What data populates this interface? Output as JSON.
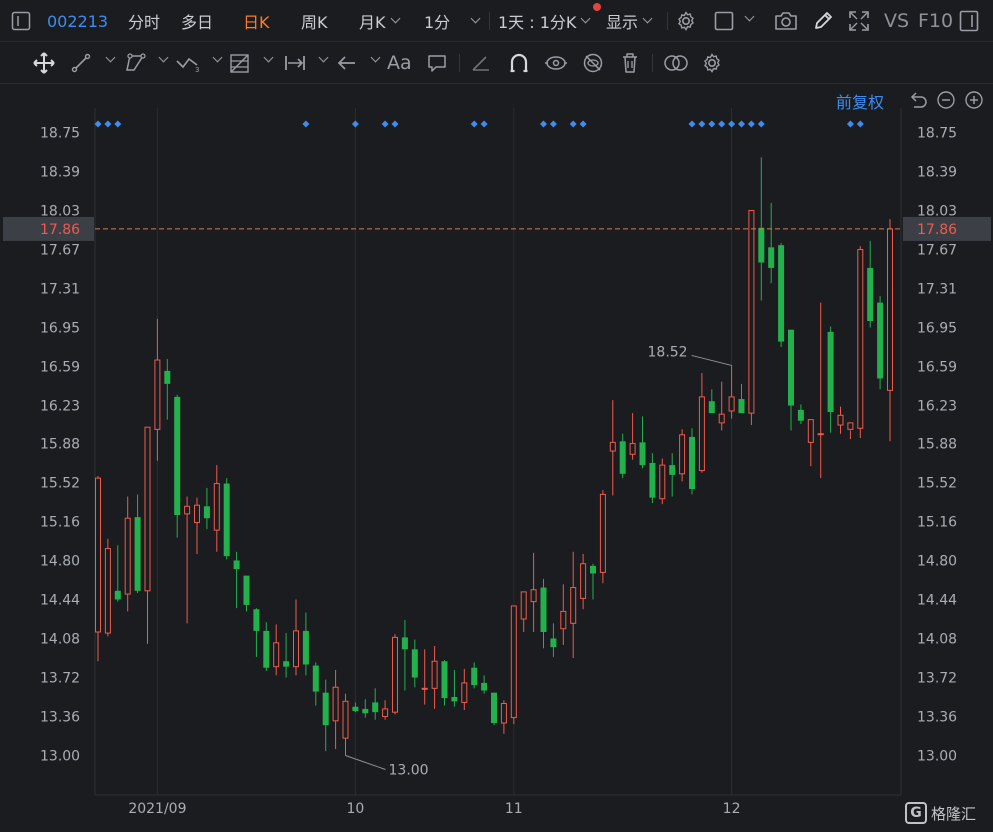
{
  "topbar": {
    "stock_code": "002213",
    "tabs": [
      {
        "label": "分时",
        "active": false
      },
      {
        "label": "多日",
        "active": false
      },
      {
        "label": "日K",
        "active": true
      },
      {
        "label": "周K",
        "active": false
      },
      {
        "label": "月K",
        "active": false
      }
    ],
    "interval": "1分",
    "range": "1天 : 1分K",
    "display": "显示",
    "vs_label": "VS",
    "f10_label": "F10",
    "icons": [
      "sidebar-toggle-icon",
      "settings-gear-icon",
      "square-layout-icon",
      "camera-icon",
      "pencil-icon",
      "expand-icon",
      "window-icon"
    ]
  },
  "toolbar": {
    "icons": [
      "move-crosshair-icon",
      "line-tool-icon",
      "polyline-tool-icon",
      "wave-tool-icon",
      "fib-grid-icon",
      "measure-range-icon",
      "arrow-left-icon",
      "text-aa-icon",
      "comment-icon",
      "angle-icon",
      "magnet-icon",
      "visibility-icon",
      "hide-icon",
      "trash-icon",
      "overlap-icon",
      "settings-icon"
    ],
    "text_label": "Aa"
  },
  "price_adjust": "前复权",
  "colors": {
    "up": "#ef5b4b",
    "down": "#22b14c",
    "background": "#1b1c1f",
    "grid": "#2b2c30",
    "accent": "#3d8cf0",
    "last_price_line": "#e07b3d",
    "event_marker": "#3d8cf0"
  },
  "brand": {
    "mark": "G",
    "name": "格隆汇"
  },
  "chart_data": {
    "type": "candlestick",
    "y_ticks": [
      "18.75",
      "18.39",
      "18.03",
      "17.67",
      "17.31",
      "16.95",
      "16.59",
      "16.23",
      "15.88",
      "15.52",
      "15.16",
      "14.80",
      "14.44",
      "14.08",
      "13.72",
      "13.36",
      "13.00"
    ],
    "ylim": [
      13.0,
      18.75
    ],
    "x_labels": [
      {
        "label": "2021/09",
        "index": 6
      },
      {
        "label": "10",
        "index": 26
      },
      {
        "label": "11",
        "index": 42
      },
      {
        "label": "12",
        "index": 64
      }
    ],
    "last_price": "17.86",
    "high_annotation": {
      "label": "18.52",
      "index": 64
    },
    "low_annotation": {
      "label": "13.00",
      "index": 25
    },
    "event_markers": [
      0,
      1,
      2,
      21,
      26,
      29,
      30,
      38,
      39,
      45,
      46,
      48,
      49,
      60,
      61,
      62,
      63,
      64,
      65,
      66,
      67,
      76,
      77
    ],
    "candles": [
      {
        "o": 14.14,
        "h": 15.58,
        "l": 13.87,
        "c": 15.56
      },
      {
        "o": 14.13,
        "h": 15.0,
        "l": 14.1,
        "c": 14.91
      },
      {
        "o": 14.52,
        "h": 14.94,
        "l": 14.42,
        "c": 14.44
      },
      {
        "o": 14.49,
        "h": 15.39,
        "l": 14.33,
        "c": 15.19
      },
      {
        "o": 15.2,
        "h": 15.41,
        "l": 14.5,
        "c": 14.52
      },
      {
        "o": 14.52,
        "h": 15.02,
        "l": 14.03,
        "c": 16.03
      },
      {
        "o": 16.01,
        "h": 17.03,
        "l": 15.72,
        "c": 16.65
      },
      {
        "o": 16.55,
        "h": 16.66,
        "l": 16.1,
        "c": 16.43
      },
      {
        "o": 16.31,
        "h": 16.33,
        "l": 15.01,
        "c": 15.22
      },
      {
        "o": 15.23,
        "h": 15.39,
        "l": 14.22,
        "c": 15.3
      },
      {
        "o": 15.15,
        "h": 15.38,
        "l": 14.86,
        "c": 15.31
      },
      {
        "o": 15.3,
        "h": 15.47,
        "l": 15.09,
        "c": 15.19
      },
      {
        "o": 15.08,
        "h": 15.68,
        "l": 14.88,
        "c": 15.51
      },
      {
        "o": 15.51,
        "h": 15.56,
        "l": 14.81,
        "c": 14.84
      },
      {
        "o": 14.8,
        "h": 14.88,
        "l": 14.36,
        "c": 14.72
      },
      {
        "o": 14.66,
        "h": 14.66,
        "l": 14.33,
        "c": 14.39
      },
      {
        "o": 14.35,
        "h": 14.36,
        "l": 13.91,
        "c": 14.15
      },
      {
        "o": 14.15,
        "h": 14.23,
        "l": 13.78,
        "c": 13.81
      },
      {
        "o": 13.82,
        "h": 14.21,
        "l": 13.74,
        "c": 14.04
      },
      {
        "o": 13.87,
        "h": 14.13,
        "l": 13.72,
        "c": 13.82
      },
      {
        "o": 13.82,
        "h": 14.44,
        "l": 13.74,
        "c": 14.15
      },
      {
        "o": 14.15,
        "h": 14.32,
        "l": 13.74,
        "c": 13.84
      },
      {
        "o": 13.83,
        "h": 13.86,
        "l": 13.46,
        "c": 13.59
      },
      {
        "o": 13.58,
        "h": 13.7,
        "l": 13.04,
        "c": 13.28
      },
      {
        "o": 13.32,
        "h": 13.79,
        "l": 13.06,
        "c": 13.63
      },
      {
        "o": 13.16,
        "h": 13.57,
        "l": 13.0,
        "c": 13.5
      },
      {
        "o": 13.45,
        "h": 13.49,
        "l": 13.4,
        "c": 13.41
      },
      {
        "o": 13.43,
        "h": 13.52,
        "l": 13.35,
        "c": 13.39
      },
      {
        "o": 13.49,
        "h": 13.62,
        "l": 13.33,
        "c": 13.4
      },
      {
        "o": 13.36,
        "h": 13.51,
        "l": 13.33,
        "c": 13.43
      },
      {
        "o": 13.4,
        "h": 14.12,
        "l": 13.38,
        "c": 14.09
      },
      {
        "o": 14.09,
        "h": 14.25,
        "l": 13.6,
        "c": 13.98
      },
      {
        "o": 13.98,
        "h": 14.07,
        "l": 13.63,
        "c": 13.72
      },
      {
        "o": 13.62,
        "h": 13.98,
        "l": 13.47,
        "c": 13.62
      },
      {
        "o": 13.62,
        "h": 14.01,
        "l": 13.43,
        "c": 13.87
      },
      {
        "o": 13.87,
        "h": 13.88,
        "l": 13.46,
        "c": 13.53
      },
      {
        "o": 13.54,
        "h": 13.79,
        "l": 13.45,
        "c": 13.5
      },
      {
        "o": 13.49,
        "h": 13.8,
        "l": 13.42,
        "c": 13.67
      },
      {
        "o": 13.81,
        "h": 13.86,
        "l": 13.62,
        "c": 13.65
      },
      {
        "o": 13.67,
        "h": 13.74,
        "l": 13.57,
        "c": 13.6
      },
      {
        "o": 13.58,
        "h": 13.58,
        "l": 13.28,
        "c": 13.3
      },
      {
        "o": 13.3,
        "h": 13.51,
        "l": 13.2,
        "c": 13.48
      },
      {
        "o": 13.35,
        "h": 14.37,
        "l": 13.29,
        "c": 14.38
      },
      {
        "o": 14.26,
        "h": 14.44,
        "l": 14.14,
        "c": 14.51
      },
      {
        "o": 14.42,
        "h": 14.87,
        "l": 14.14,
        "c": 14.53
      },
      {
        "o": 14.55,
        "h": 14.63,
        "l": 13.99,
        "c": 14.14
      },
      {
        "o": 14.08,
        "h": 14.22,
        "l": 13.91,
        "c": 14.0
      },
      {
        "o": 14.17,
        "h": 14.58,
        "l": 14.02,
        "c": 14.33
      },
      {
        "o": 14.22,
        "h": 14.88,
        "l": 13.9,
        "c": 14.55
      },
      {
        "o": 14.45,
        "h": 14.86,
        "l": 14.35,
        "c": 14.77
      },
      {
        "o": 14.75,
        "h": 14.77,
        "l": 14.44,
        "c": 14.68
      },
      {
        "o": 14.69,
        "h": 15.45,
        "l": 14.59,
        "c": 15.41
      },
      {
        "o": 15.81,
        "h": 16.28,
        "l": 15.4,
        "c": 15.89
      },
      {
        "o": 15.9,
        "h": 15.97,
        "l": 15.56,
        "c": 15.6
      },
      {
        "o": 15.78,
        "h": 16.16,
        "l": 15.73,
        "c": 15.88
      },
      {
        "o": 15.89,
        "h": 16.13,
        "l": 15.65,
        "c": 15.68
      },
      {
        "o": 15.7,
        "h": 15.79,
        "l": 15.33,
        "c": 15.38
      },
      {
        "o": 15.37,
        "h": 15.74,
        "l": 15.32,
        "c": 15.68
      },
      {
        "o": 15.68,
        "h": 15.79,
        "l": 15.39,
        "c": 15.59
      },
      {
        "o": 15.6,
        "h": 16.01,
        "l": 15.53,
        "c": 15.96
      },
      {
        "o": 15.94,
        "h": 16.02,
        "l": 15.41,
        "c": 15.46
      },
      {
        "o": 15.63,
        "h": 16.53,
        "l": 15.61,
        "c": 16.31
      },
      {
        "o": 16.27,
        "h": 16.38,
        "l": 16.21,
        "c": 16.16
      },
      {
        "o": 16.07,
        "h": 16.45,
        "l": 16.0,
        "c": 16.15
      },
      {
        "o": 16.18,
        "h": 16.6,
        "l": 16.11,
        "c": 16.31
      },
      {
        "o": 16.29,
        "h": 16.43,
        "l": 16.16,
        "c": 16.16
      },
      {
        "o": 16.16,
        "h": 16.62,
        "l": 16.05,
        "c": 18.03
      },
      {
        "o": 17.87,
        "h": 18.52,
        "l": 17.2,
        "c": 17.55
      },
      {
        "o": 17.69,
        "h": 18.1,
        "l": 17.36,
        "c": 17.5
      },
      {
        "o": 17.71,
        "h": 17.73,
        "l": 16.77,
        "c": 16.82
      },
      {
        "o": 16.93,
        "h": 16.93,
        "l": 16.0,
        "c": 16.23
      },
      {
        "o": 16.19,
        "h": 16.24,
        "l": 16.06,
        "c": 16.09
      },
      {
        "o": 15.89,
        "h": 16.07,
        "l": 15.67,
        "c": 16.1
      },
      {
        "o": 15.97,
        "h": 17.18,
        "l": 15.56,
        "c": 15.97
      },
      {
        "o": 16.91,
        "h": 16.96,
        "l": 15.98,
        "c": 16.17
      },
      {
        "o": 16.05,
        "h": 16.22,
        "l": 15.97,
        "c": 16.14
      },
      {
        "o": 16.01,
        "h": 16.0,
        "l": 15.92,
        "c": 16.07
      },
      {
        "o": 16.02,
        "h": 17.7,
        "l": 15.93,
        "c": 17.67
      },
      {
        "o": 17.5,
        "h": 17.75,
        "l": 16.95,
        "c": 17.01
      },
      {
        "o": 17.18,
        "h": 17.24,
        "l": 16.38,
        "c": 16.48
      },
      {
        "o": 16.37,
        "h": 17.95,
        "l": 15.9,
        "c": 17.86
      }
    ]
  }
}
